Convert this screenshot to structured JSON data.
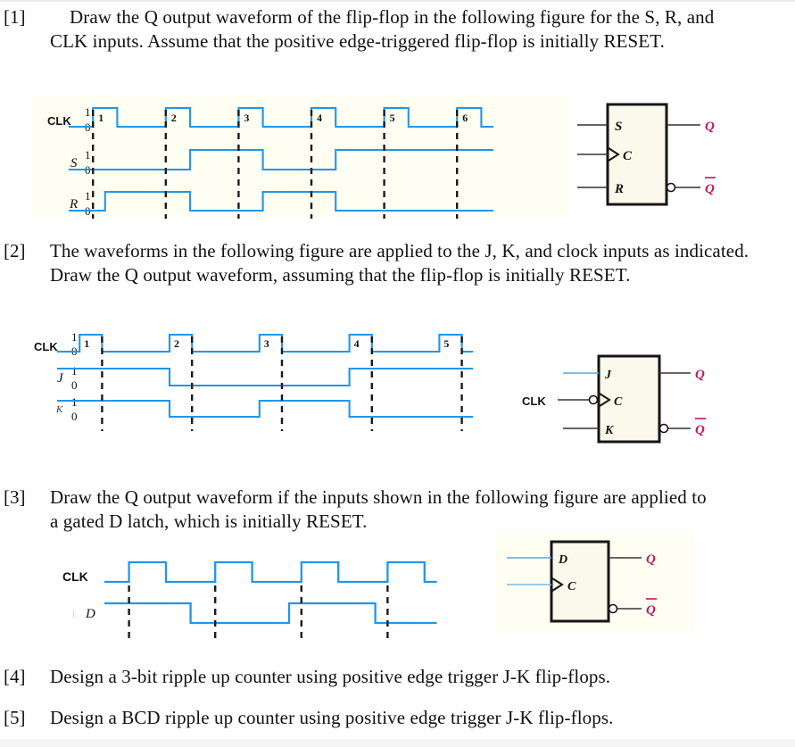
{
  "colors": {
    "wave": "#2196e8",
    "dashed": "#1a1a1a",
    "panel_bg": "#fffef2",
    "box_fill": "#fbf8ec",
    "box_stroke": "#151515",
    "q_label": "#c2185b",
    "text": "#111111"
  },
  "questions": [
    {
      "num": "[1]",
      "text": "Draw the Q output waveform of the flip-flop in the following figure for the S, R, and CLK inputs. Assume that the positive edge-triggered flip-flop is initially RESET."
    },
    {
      "num": "[2]",
      "text": "The waveforms in the following figure are applied to the J, K, and clock inputs as indicated. Draw the Q output waveform, assuming that the flip-flop is initially RESET."
    },
    {
      "num": "[3]",
      "text": "Draw the Q output waveform if the inputs shown in the following figure are applied to a gated D latch, which is initially RESET."
    },
    {
      "num": "[4]",
      "text": "Design a 3-bit ripple up counter using positive edge trigger J-K flip-flops."
    },
    {
      "num": "[5]",
      "text": "Design a BCD ripple up counter using positive edge trigger J-K flip-flops."
    }
  ],
  "fig1": {
    "signals": [
      {
        "name": "CLK",
        "hi": "1",
        "lo": "0"
      },
      {
        "name": "S",
        "hi": "1",
        "lo": "0"
      },
      {
        "name": "R",
        "hi": "1",
        "lo": "0"
      }
    ],
    "pulse_labels": [
      "1",
      "2",
      "3",
      "4",
      "5",
      "6"
    ],
    "clk": [
      0,
      0,
      1,
      1,
      0,
      0,
      0,
      0,
      1,
      1,
      0,
      0,
      0,
      0,
      1,
      1,
      0,
      0,
      0,
      0,
      1,
      1,
      0,
      0,
      0,
      0,
      1,
      1,
      0,
      0,
      0,
      0,
      1,
      1,
      0,
      0
    ],
    "s": [
      0,
      0,
      0,
      0,
      0,
      0,
      0,
      0,
      0,
      0,
      1,
      1,
      1,
      1,
      1,
      1,
      0,
      0,
      0,
      0,
      0,
      0,
      1,
      1,
      1,
      1,
      1,
      1,
      1,
      1,
      1,
      1,
      1,
      1,
      1,
      1
    ],
    "r": [
      0,
      0,
      0,
      1,
      1,
      1,
      1,
      1,
      1,
      1,
      0,
      0,
      0,
      0,
      0,
      0,
      1,
      1,
      1,
      1,
      1,
      1,
      0,
      0,
      0,
      0,
      0,
      0,
      0,
      0,
      0,
      0,
      0,
      0,
      0,
      0
    ],
    "symbol": {
      "inputs": [
        "S",
        "C",
        "R"
      ],
      "outputs": [
        "Q",
        "Q̅"
      ],
      "clock_triangle": true,
      "qbar_bubble": true
    }
  },
  "fig2": {
    "signals": [
      {
        "name": "CLK",
        "hi": "1",
        "lo": "0"
      },
      {
        "name": "J",
        "hi": "1",
        "lo": "0"
      },
      {
        "name": "K",
        "hi": "1",
        "lo": "0"
      }
    ],
    "pulse_labels": [
      "1",
      "2",
      "3",
      "4",
      "5"
    ],
    "clk": [
      0,
      0,
      1,
      1,
      0,
      0,
      0,
      0,
      0,
      0,
      1,
      1,
      0,
      0,
      0,
      0,
      0,
      0,
      1,
      1,
      0,
      0,
      0,
      0,
      0,
      0,
      1,
      1,
      0,
      0,
      0,
      0,
      0,
      0,
      1,
      1,
      0,
      0
    ],
    "j": [
      1,
      1,
      1,
      1,
      1,
      1,
      1,
      1,
      1,
      1,
      0,
      0,
      0,
      0,
      0,
      0,
      0,
      0,
      0,
      0,
      0,
      0,
      0,
      0,
      0,
      0,
      1,
      1,
      1,
      1,
      1,
      1,
      1,
      1,
      1,
      1,
      1,
      1
    ],
    "k": [
      1,
      1,
      1,
      1,
      1,
      1,
      1,
      1,
      1,
      1,
      0,
      0,
      0,
      0,
      0,
      0,
      0,
      0,
      1,
      1,
      1,
      1,
      1,
      1,
      1,
      1,
      0,
      0,
      0,
      0,
      0,
      0,
      0,
      0,
      0,
      0,
      0,
      0
    ],
    "symbol": {
      "inputs": [
        "J",
        "C",
        "K"
      ],
      "clk_label": "CLK",
      "outputs": [
        "Q",
        "Q̅"
      ],
      "clock_triangle": true,
      "clock_bubble": true,
      "qbar_bubble": true
    }
  },
  "fig3": {
    "signals": [
      {
        "name": "CLK"
      },
      {
        "name": "D"
      }
    ],
    "clk": [
      0,
      0,
      1,
      1,
      1,
      0,
      0,
      0,
      0,
      1,
      1,
      1,
      0,
      0,
      0,
      0,
      1,
      1,
      1,
      0,
      0,
      0,
      0,
      1,
      1,
      1,
      0,
      0
    ],
    "d": [
      1,
      1,
      1,
      1,
      1,
      1,
      1,
      0,
      0,
      0,
      0,
      0,
      0,
      0,
      0,
      1,
      1,
      1,
      1,
      1,
      1,
      1,
      0,
      0,
      0,
      0,
      0,
      0
    ],
    "symbol": {
      "inputs": [
        "D",
        "C"
      ],
      "outputs": [
        "Q",
        "Q̅"
      ],
      "clock_triangle": true,
      "qbar_bubble": true
    }
  }
}
